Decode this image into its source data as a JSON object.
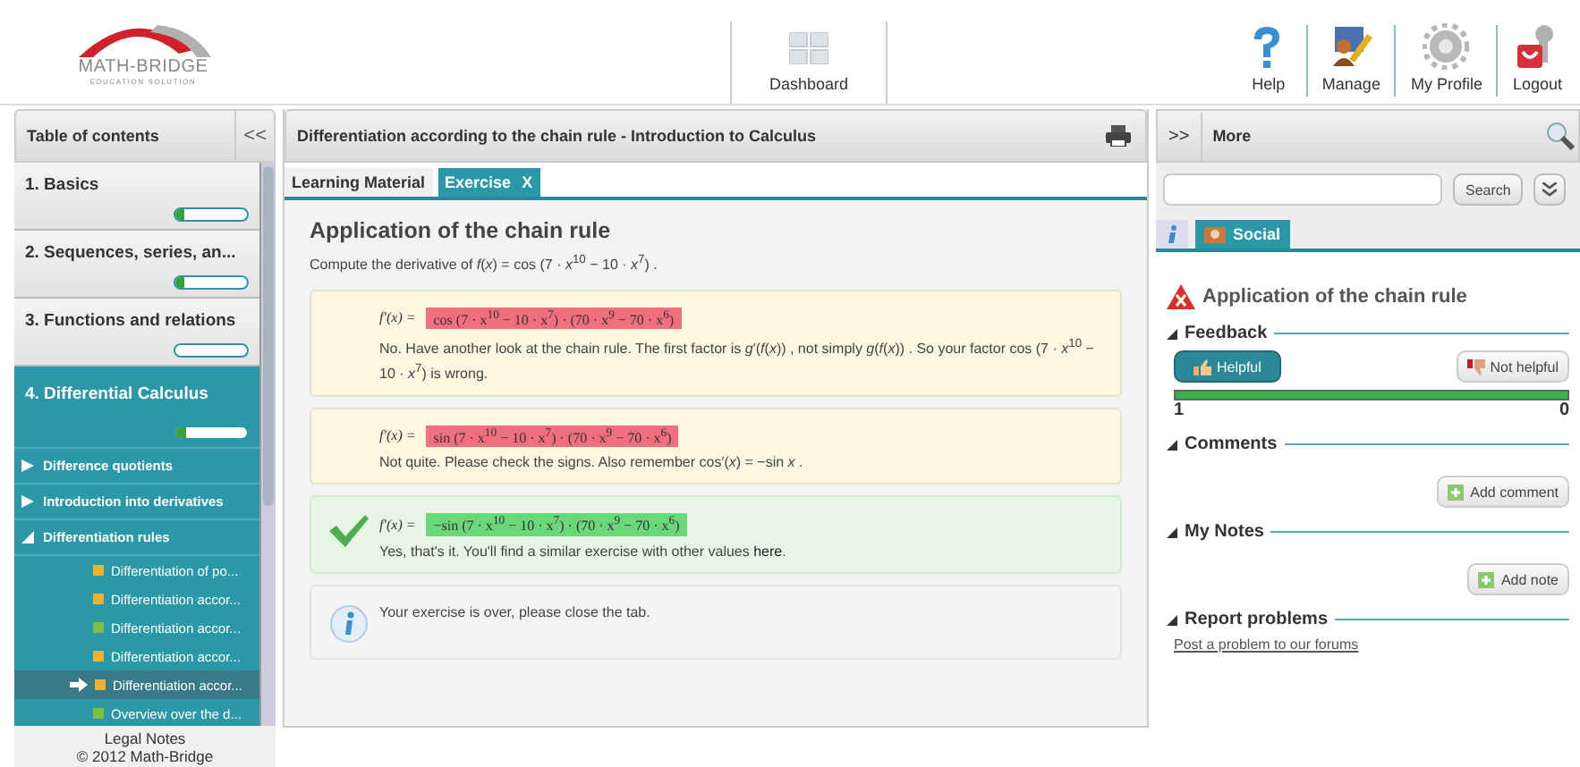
{
  "header": {
    "logo": "MATH-BRIDGE",
    "logo_tagline": "EDUCATION SOLUTION",
    "dashboard": "Dashboard",
    "nav": [
      {
        "kind": "help",
        "label": "Help"
      },
      {
        "kind": "manage",
        "label": "Manage"
      },
      {
        "kind": "profile",
        "label": "My Profile"
      },
      {
        "kind": "logout",
        "label": "Logout"
      }
    ]
  },
  "toc": {
    "title": "Table of contents",
    "collapse": "<<",
    "chapters": [
      {
        "label": "1. Basics",
        "level": 0.12,
        "selected": false
      },
      {
        "label": "2. Sequences, series, an...",
        "level": 0.12,
        "selected": false
      },
      {
        "label": "3. Functions and relations",
        "level": 0,
        "selected": false
      },
      {
        "label": "4. Differential Calculus",
        "level": 0.15,
        "selected": true
      }
    ],
    "topics": [
      {
        "label": "Difference quotients",
        "expanded": false
      },
      {
        "label": "Introduction into derivatives",
        "expanded": false
      },
      {
        "label": "Differentiation rules",
        "expanded": true,
        "children": [
          {
            "label": "Differentiation of po...",
            "color": "#f0b030",
            "selected": false
          },
          {
            "label": "Differentiation accor...",
            "color": "#f0b030",
            "selected": false
          },
          {
            "label": "Differentiation accor...",
            "color": "#7cc040",
            "selected": false
          },
          {
            "label": "Differentiation accor...",
            "color": "#f0b030",
            "selected": false
          },
          {
            "label": "Differentiation accor...",
            "color": "#f0b030",
            "selected": true
          },
          {
            "label": "Overview over the d...",
            "color": "#7cc040",
            "selected": false
          }
        ]
      }
    ],
    "footer": [
      "Legal Notes",
      "© 2012 Math-Bridge"
    ]
  },
  "content": {
    "title": "Differentiation according to the chain rule - Introduction to Calculus",
    "tabs": [
      {
        "label": "Learning Material",
        "selected": false
      },
      {
        "label": "Exercise",
        "close": "X",
        "selected": true
      }
    ],
    "heading": "Application of the chain rule",
    "prompt": "Compute the derivative of *f*(*x*) = cos (7 · *x*$^{10}$ − 10 · *x*$^{7}$) .",
    "answers": [
      {
        "kind": "wrong",
        "lhs": "f′(x) =",
        "expression": "cos (7 · x$^{10}$ − 10 · x$^{7}$) · (70 · x$^{9}$ − 70 · x$^{6}$)",
        "feedback": "No. Have another look at the chain rule. The first factor is *g*′(*f*(*x*)) , not simply *g*(*f*(*x*)) . So your factor cos (7 · *x*$^{10}$ − 10 · *x*$^{7}$) is wrong."
      },
      {
        "kind": "wrong",
        "lhs": "f′(x) =",
        "expression": "sin (7 · x$^{10}$ − 10 · x$^{7}$) · (70 · x$^{9}$ − 70 · x$^{6}$)",
        "feedback": "Not quite. Please check the signs. Also remember cos′(*x*) = −sin *x* ."
      },
      {
        "kind": "correct",
        "lhs": "f′(x) =",
        "expression": "−sin (7 · x$^{10}$ − 10 · x$^{7}$) · (70 · x$^{9}$ − 70 · x$^{6}$)",
        "feedback": "Yes, that's it. You'll find a similar exercise with other values",
        "link": "here",
        "after": "."
      },
      {
        "kind": "info",
        "feedback": "Your exercise is over, please close the tab."
      }
    ]
  },
  "more": {
    "expand": ">>",
    "title": "More",
    "search_button": "Search",
    "tabs": [
      {
        "kind": "info",
        "selected": false
      },
      {
        "kind": "social",
        "label": "Social",
        "selected": true
      }
    ],
    "heading": "Application of the chain rule",
    "sections": [
      {
        "kind": "feedback",
        "title": "Feedback",
        "expanded": true,
        "buttons": [
          {
            "label": "Helpful",
            "selected": true
          },
          {
            "label": "Not helpful",
            "selected": false
          }
        ],
        "level": 1,
        "counts": [
          "1",
          "0"
        ]
      },
      {
        "kind": "button",
        "title": "Comments",
        "expanded": true,
        "button": "Add comment"
      },
      {
        "kind": "button",
        "title": "My Notes",
        "expanded": true,
        "button": "Add note"
      },
      {
        "kind": "link",
        "title": "Report problems",
        "expanded": true,
        "link": "Post a problem to our forums"
      }
    ]
  }
}
